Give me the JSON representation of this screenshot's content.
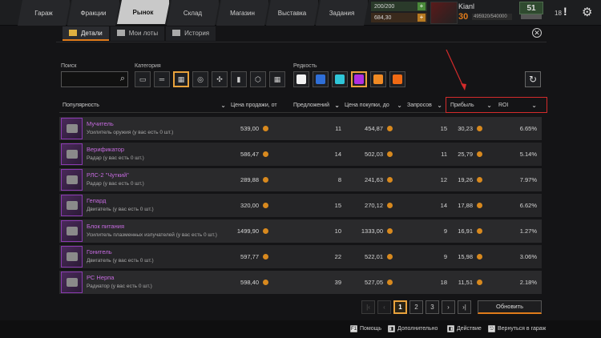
{
  "nav": {
    "tabs": [
      "Гараж",
      "Фракции",
      "Рынок",
      "Склад",
      "Магазин",
      "Выставка",
      "Задания"
    ],
    "active": 2
  },
  "resources": {
    "green": "200/200",
    "orange": "684,30"
  },
  "player": {
    "name": "Kianl",
    "level": "30",
    "xp": "495920/540000",
    "badge": "51",
    "notifications": "18"
  },
  "subtabs": [
    "Детали",
    "Мои лоты",
    "История"
  ],
  "filters": {
    "search_label": "Поиск",
    "category_label": "Категория",
    "rarity_label": "Редкость",
    "search_placeholder": "",
    "categories": [
      "cabin-icon",
      "weapon-icon",
      "parts-icon",
      "wheel-icon",
      "drone-icon",
      "bottle-icon",
      "cube-icon",
      "grid-icon"
    ],
    "rarity_colors": [
      "#f2f2f2",
      "#2f6fd8",
      "#2fc6d8",
      "#b02fe0",
      "#f08a24",
      "#f06a14"
    ]
  },
  "columns": {
    "popularity": "Популярность",
    "sell_price": "Цена продажи, от",
    "offers": "Предложений",
    "buy_price": "Цена покупки, до",
    "requests": "Запросов",
    "profit": "Прибыль",
    "roi": "ROI"
  },
  "rows": [
    {
      "name": "Мучитель",
      "desc": "Усилитель оружия (у вас есть 0 шт.)",
      "sell": "539,00",
      "offers": "11",
      "buy": "454,87",
      "requests": "15",
      "profit": "30,23",
      "roi": "6.65%"
    },
    {
      "name": "Верификатор",
      "desc": "Радар (у вас есть 0 шт.)",
      "sell": "586,47",
      "offers": "14",
      "buy": "502,03",
      "requests": "11",
      "profit": "25,79",
      "roi": "5.14%"
    },
    {
      "name": "РЛС-2 \"Чуткий\"",
      "desc": "Радар (у вас есть 0 шт.)",
      "sell": "289,88",
      "offers": "8",
      "buy": "241,63",
      "requests": "12",
      "profit": "19,26",
      "roi": "7.97%"
    },
    {
      "name": "Гепард",
      "desc": "Двигатель (у вас есть 0 шт.)",
      "sell": "320,00",
      "offers": "15",
      "buy": "270,12",
      "requests": "14",
      "profit": "17,88",
      "roi": "6.62%"
    },
    {
      "name": "Блок питания",
      "desc": "Усилитель плазменных излучателей (у вас есть 0 шт.)",
      "sell": "1499,90",
      "offers": "10",
      "buy": "1333,00",
      "requests": "9",
      "profit": "16,91",
      "roi": "1.27%"
    },
    {
      "name": "Гонитель",
      "desc": "Двигатель (у вас есть 0 шт.)",
      "sell": "597,77",
      "offers": "22",
      "buy": "522,01",
      "requests": "9",
      "profit": "15,98",
      "roi": "3.06%"
    },
    {
      "name": "РС Нерпа",
      "desc": "Радиатор (у вас есть 0 шт.)",
      "sell": "598,40",
      "offers": "39",
      "buy": "527,05",
      "requests": "18",
      "profit": "11,51",
      "roi": "2.18%"
    }
  ],
  "pagination": {
    "pages": [
      "1",
      "2",
      "3"
    ],
    "current": "1",
    "refresh": "Обновить"
  },
  "footer": {
    "help": "Помощь",
    "more": "Дополнительно",
    "action": "Действие",
    "back": "Вернуться в гараж",
    "help_key": "F1"
  },
  "colors": {
    "accent": "#e07b1a",
    "epic": "#c66be0",
    "highlight": "#d32b2b"
  }
}
